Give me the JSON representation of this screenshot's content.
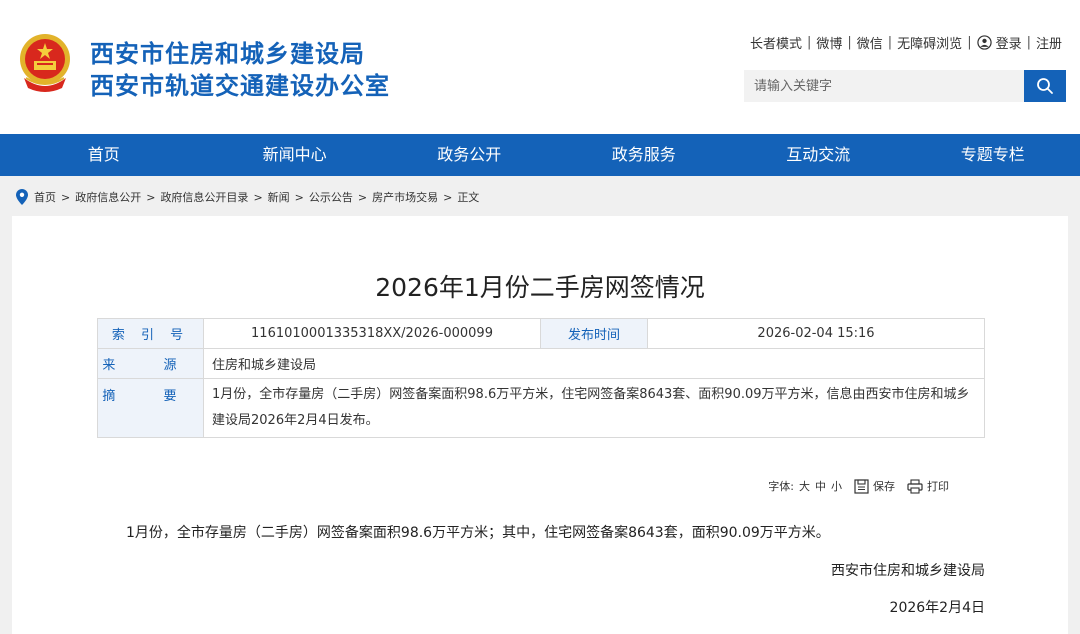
{
  "header": {
    "title_line1": "西安市住房和城乡建设局",
    "title_line2": "西安市轨道交通建设办公室",
    "emblem_icon": "national-emblem-icon",
    "links": [
      "长者模式",
      "微博",
      "微信",
      "无障碍浏览",
      "登录",
      "注册"
    ],
    "search_placeholder": "请输入关键字",
    "accent_color": "#1462b8"
  },
  "nav": {
    "items": [
      "首页",
      "新闻中心",
      "政务公开",
      "政务服务",
      "互动交流",
      "专题专栏"
    ]
  },
  "breadcrumb": {
    "items": [
      "首页",
      "政府信息公开",
      "政府信息公开目录",
      "新闻",
      "公示公告",
      "房产市场交易"
    ],
    "current": "正文",
    "separator": ">"
  },
  "article": {
    "title": "2026年1月份二手房网签情况",
    "meta": {
      "index_label": "索 引 号",
      "index_value": "1161010001335318XX/2026-000099",
      "publish_label": "发布时间",
      "publish_value": "2026-02-04 15:16",
      "source_label": "来 源",
      "source_value": "住房和城乡建设局",
      "summary_label": "摘 要",
      "summary_value": "1月份，全市存量房（二手房）网签备案面积98.6万平方米，住宅网签备案8643套、面积90.09万平方米，信息由西安市住房和城乡建设局2026年2月4日发布。"
    },
    "tools": {
      "font_label": "字体:",
      "sizes": [
        "大",
        "中",
        "小"
      ],
      "save": "保存",
      "print": "打印"
    },
    "body": "1月份，全市存量房（二手房）网签备案面积98.6万平方米；其中，住宅网签备案8643套，面积90.09万平方米。",
    "sign_org": "西安市住房和城乡建设局",
    "sign_date": "2026年2月4日"
  }
}
